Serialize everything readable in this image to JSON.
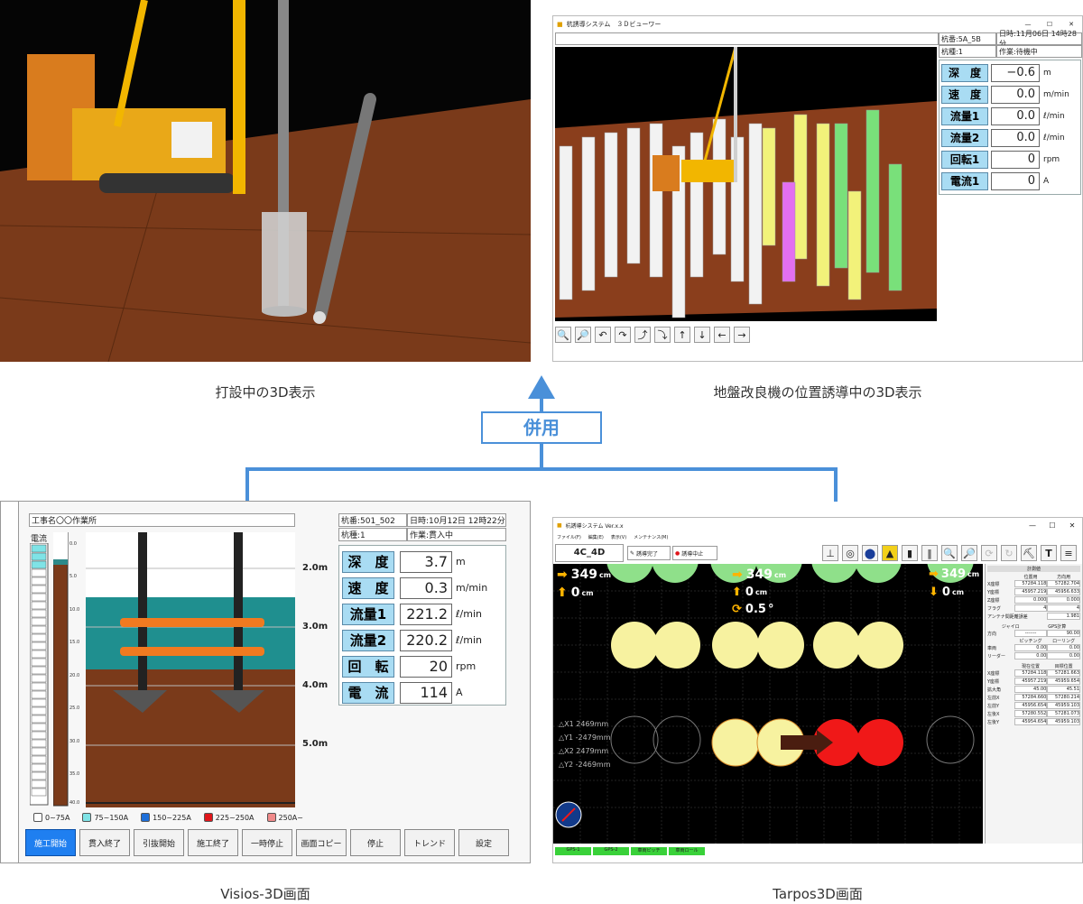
{
  "captions": {
    "top_left": "打設中の3D表示",
    "top_right": "地盤改良機の位置誘導中の3D表示",
    "bottom_left": "Visios-3D画面",
    "bottom_right": "Tarpos3D画面"
  },
  "connector": {
    "label": "併用",
    "color": "#4a90d9"
  },
  "viewer3d": {
    "window_title": "杭誘導システム　３Ｄビューワー",
    "pile_no": "杭番:5A_5B",
    "datetime": "日時:11月06日 14時28分",
    "pile_type": "杭種:1",
    "work": "作業:待機中",
    "gauges": [
      {
        "label": "深　度",
        "value": "−0.6",
        "unit": "m"
      },
      {
        "label": "速　度",
        "value": "0.0",
        "unit": "m/min"
      },
      {
        "label": "流量1",
        "value": "0.0",
        "unit": "ℓ/min"
      },
      {
        "label": "流量2",
        "value": "0.0",
        "unit": "ℓ/min"
      },
      {
        "label": "回転1",
        "value": "0",
        "unit": "rpm"
      },
      {
        "label": "電流1",
        "value": "0",
        "unit": "A"
      }
    ],
    "toolbar_icons": [
      "zoom-in-icon",
      "zoom-out-icon",
      "rotate-left-icon",
      "rotate-right-icon",
      "tilt-up-icon",
      "tilt-down-icon",
      "arrow-up-icon",
      "arrow-down-icon",
      "arrow-left-icon",
      "arrow-right-icon"
    ],
    "window_controls": [
      "—",
      "☐",
      "✕"
    ]
  },
  "visios": {
    "project": "工事名〇〇作業所",
    "pile_no": "杭番:501_502",
    "datetime": "日時:10月12日 12時22分",
    "pile_type": "杭種:1",
    "work": "作業:貫入中",
    "current_label": "電流",
    "gauges": [
      {
        "label": "深　度",
        "value": "3.7",
        "unit": "m"
      },
      {
        "label": "速　度",
        "value": "0.3",
        "unit": "m/min"
      },
      {
        "label": "流量1",
        "value": "221.2",
        "unit": "ℓ/min"
      },
      {
        "label": "流量2",
        "value": "220.2",
        "unit": "ℓ/min"
      },
      {
        "label": "回　転",
        "value": "20",
        "unit": "rpm"
      },
      {
        "label": "電　流",
        "value": "114",
        "unit": "A"
      }
    ],
    "depth_marks": [
      "2.0m",
      "3.0m",
      "4.0m",
      "5.0m"
    ],
    "scale_ticks": [
      "0.0",
      "5.0",
      "10.0",
      "15.0",
      "20.0",
      "25.0",
      "30.0",
      "35.0",
      "40.0"
    ],
    "legend": [
      {
        "label": "0~75A",
        "color": "#ffffff"
      },
      {
        "label": "75~150A",
        "color": "#7fe3e6"
      },
      {
        "label": "150~225A",
        "color": "#1e6fd9"
      },
      {
        "label": "225~250A",
        "color": "#e0151a"
      },
      {
        "label": "250A~",
        "color": "#f08a8a"
      }
    ],
    "buttons": [
      "施工開始",
      "貫入終了",
      "引抜開始",
      "施工終了",
      "一時停止",
      "画面コピー",
      "停止",
      "トレンド",
      "設定"
    ]
  },
  "tarpos": {
    "window_title": "杭誘導システム Ver.x.x",
    "menu": [
      "ファイル(F)",
      "編集(E)",
      "表示(V)",
      "メンテナンス(M)"
    ],
    "tab": "4C_4D",
    "btn_complete": "誘導完了",
    "btn_stop": "誘導中止",
    "readouts": {
      "left_x": "349",
      "left_y": "0",
      "mid_x": "349",
      "mid_y": "0",
      "mid_angle": "0.5",
      "right_x": "349",
      "right_y": "0",
      "unit_cm": "cm",
      "unit_deg": "°"
    },
    "deltas": [
      "△X1 2469mm",
      "△Y1 -2479mm",
      "△X2 2479mm",
      "△Y2 -2469mm"
    ],
    "side_title": "計測値",
    "side_headers": [
      "位置用",
      "方向用"
    ],
    "side_rows": [
      [
        "X座標",
        "57284.118",
        "57282.704"
      ],
      [
        "Y座標",
        "45957.219",
        "45956.633"
      ],
      [
        "Z座標",
        "0.000",
        "0.000"
      ],
      [
        "フラグ",
        "4",
        "4"
      ],
      [
        "アンテナ間距離誤差",
        "",
        "1.981"
      ]
    ],
    "side_section2": [
      "ジャイロ",
      "GPS計算"
    ],
    "side_rows2": [
      [
        "方向",
        "-------",
        "90.00"
      ],
      [
        "",
        "ピッチング",
        "ローリング"
      ],
      [
        "車両",
        "0.00",
        "0.00"
      ],
      [
        "リーダー",
        "0.00",
        "0.00"
      ]
    ],
    "side_section3": [
      "現在位置",
      "目標位置"
    ],
    "side_rows3": [
      [
        "X座標",
        "57284.118",
        "57281.663"
      ],
      [
        "Y座標",
        "45957.219",
        "45959.654"
      ],
      [
        "拡大角",
        "45.00",
        "45.51"
      ],
      [
        "左前X",
        "57284.660",
        "57280.214"
      ],
      [
        "左前Y",
        "45956.654",
        "45959.103"
      ],
      [
        "左後X",
        "57280.552",
        "57281.073"
      ],
      [
        "左後Y",
        "45954.654",
        "45959.103"
      ]
    ],
    "status_bar": [
      "GPS-1",
      "GPS-2",
      "車両ピッチ",
      "車両ロール"
    ],
    "toolbar_icons": [
      "pile-icon",
      "target-icon",
      "stop-icon",
      "bell-icon",
      "light-icon",
      "ruler-icon",
      "zoom-in-icon",
      "zoom-out-icon",
      "refresh-icon",
      "reload-icon",
      "crane-icon",
      "antenna-icon",
      "menu-icon"
    ],
    "window_controls": [
      "—",
      "☐",
      "✕"
    ]
  }
}
